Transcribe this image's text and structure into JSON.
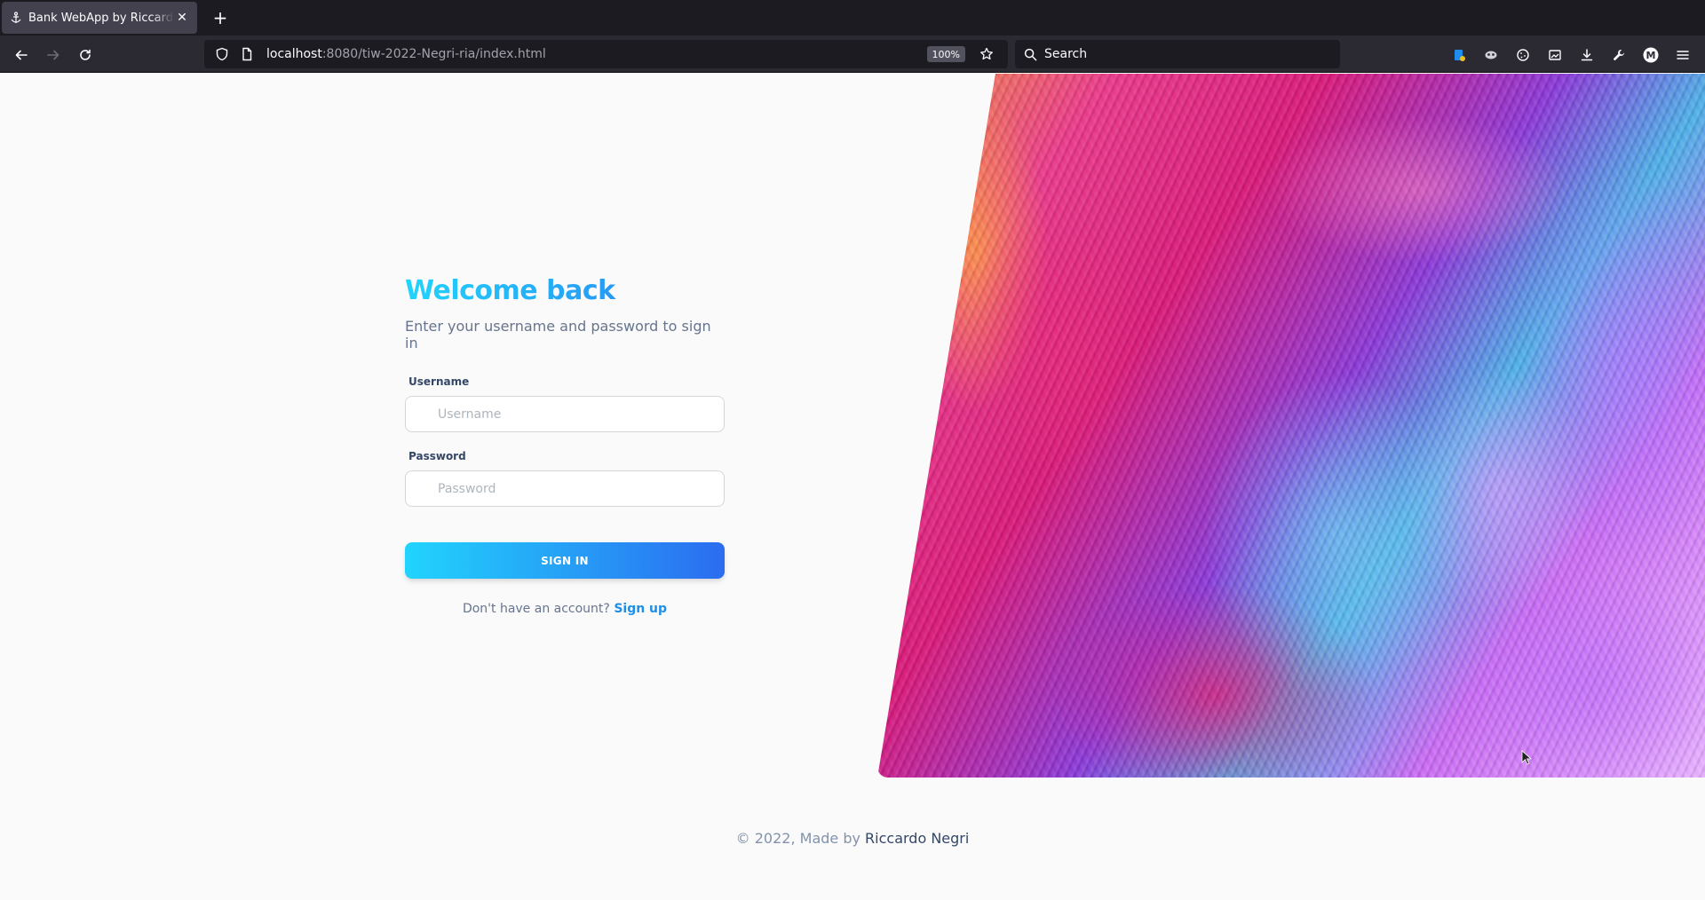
{
  "browser": {
    "tab_title": "Bank WebApp by Riccardo Negri",
    "tab_close": "✕",
    "new_tab": "+",
    "url_host": "localhost",
    "url_path": ":8080/tiw-2022-Negri-ria/index.html",
    "zoom": "100%",
    "search_placeholder": "Search",
    "profile_initial": "M"
  },
  "login": {
    "title": "Welcome back",
    "subtitle": "Enter your username and password to sign in",
    "username_label": "Username",
    "username_placeholder": "Username",
    "username_value": "",
    "password_label": "Password",
    "password_placeholder": "Password",
    "password_value": "",
    "submit_label": "SIGN IN",
    "signup_prompt": "Don't have an account?",
    "signup_link": "Sign up"
  },
  "footer": {
    "prefix": "© 2022, Made by",
    "author": "Riccardo Negri"
  },
  "colors": {
    "accent_start": "#21d4fd",
    "accent_end": "#2b6cf0",
    "link": "#1e8fe8",
    "text_muted": "#67748e"
  }
}
